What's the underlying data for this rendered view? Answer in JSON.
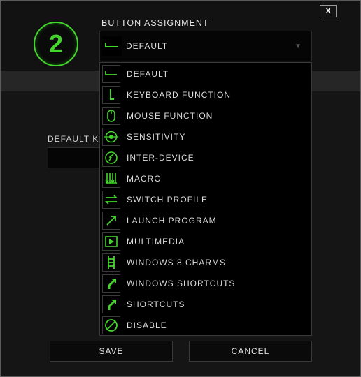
{
  "dialog": {
    "close_label": "X",
    "button_number": "2",
    "assignment_title": "BUTTON ASSIGNMENT",
    "selected_value": "DEFAULT",
    "selected_icon": "default-arrow-icon",
    "partial_label": "DEFAULT K",
    "save_label": "SAVE",
    "cancel_label": "CANCEL",
    "accent_color": "#44d62c"
  },
  "menu": {
    "items": [
      {
        "label": "DEFAULT",
        "icon": "default-arrow-icon"
      },
      {
        "label": "KEYBOARD FUNCTION",
        "icon": "keyboard-function-icon"
      },
      {
        "label": "MOUSE FUNCTION",
        "icon": "mouse-icon"
      },
      {
        "label": "SENSITIVITY",
        "icon": "sensitivity-icon"
      },
      {
        "label": "INTER-DEVICE",
        "icon": "inter-device-icon"
      },
      {
        "label": "MACRO",
        "icon": "macro-icon"
      },
      {
        "label": "SWITCH PROFILE",
        "icon": "switch-profile-icon"
      },
      {
        "label": "LAUNCH PROGRAM",
        "icon": "launch-program-icon"
      },
      {
        "label": "MULTIMEDIA",
        "icon": "multimedia-icon"
      },
      {
        "label": "WINDOWS 8 CHARMS",
        "icon": "windows-charms-icon"
      },
      {
        "label": "WINDOWS SHORTCUTS",
        "icon": "windows-shortcuts-icon"
      },
      {
        "label": "SHORTCUTS",
        "icon": "shortcuts-icon"
      },
      {
        "label": "DISABLE",
        "icon": "disable-icon"
      }
    ]
  }
}
